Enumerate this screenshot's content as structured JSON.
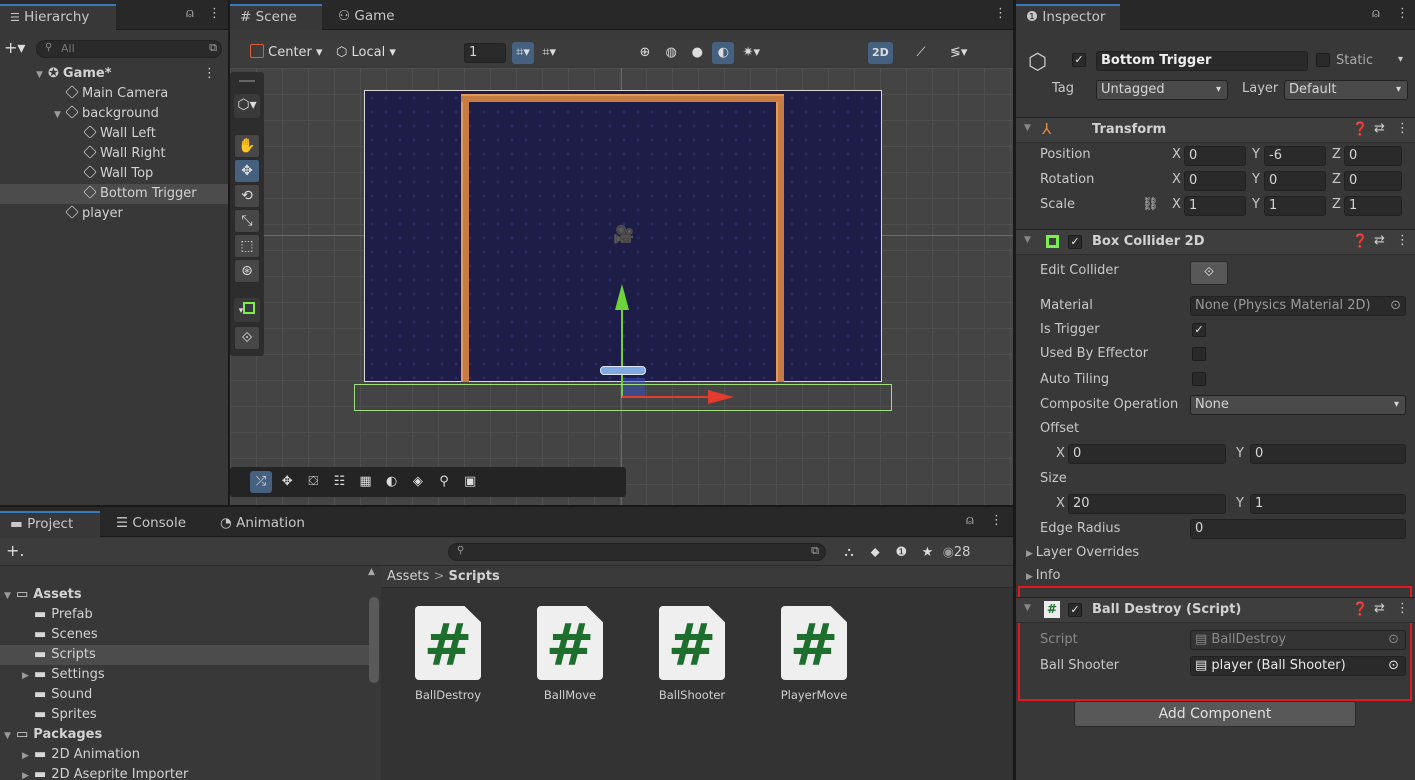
{
  "hierarchy": {
    "tab": "Hierarchy",
    "search_placeholder": "All",
    "items": [
      {
        "label": "Game*",
        "indent": 0
      },
      {
        "label": "Main Camera",
        "indent": 1
      },
      {
        "label": "background",
        "indent": 1
      },
      {
        "label": "Wall Left",
        "indent": 2
      },
      {
        "label": "Wall Right",
        "indent": 2
      },
      {
        "label": "Wall Top",
        "indent": 2
      },
      {
        "label": "Bottom Trigger",
        "indent": 2
      },
      {
        "label": "player",
        "indent": 1
      }
    ]
  },
  "scene": {
    "tab_scene": "Scene",
    "tab_game": "Game",
    "pivot_label": "Center",
    "space_label": "Local",
    "grid_value": "1",
    "mode_2d": "2D"
  },
  "inspector": {
    "tab": "Inspector",
    "object_name": "Bottom Trigger",
    "static_label": "Static",
    "tag_label": "Tag",
    "tag_value": "Untagged",
    "layer_label": "Layer",
    "layer_value": "Default",
    "transform": {
      "title": "Transform",
      "position_label": "Position",
      "rotation_label": "Rotation",
      "scale_label": "Scale",
      "position": {
        "x": "0",
        "y": "-6",
        "z": "0"
      },
      "rotation": {
        "x": "0",
        "y": "0",
        "z": "0"
      },
      "scale": {
        "x": "1",
        "y": "1",
        "z": "1"
      }
    },
    "box_collider": {
      "title": "Box Collider 2D",
      "edit_collider": "Edit Collider",
      "material_label": "Material",
      "material_value": "None (Physics Material 2D)",
      "is_trigger": "Is Trigger",
      "used_by_effector": "Used By Effector",
      "auto_tiling": "Auto Tiling",
      "composite_label": "Composite Operation",
      "composite_value": "None",
      "offset_label": "Offset",
      "offset": {
        "x": "0",
        "y": "0"
      },
      "size_label": "Size",
      "size": {
        "x": "20",
        "y": "1"
      },
      "edge_radius_label": "Edge Radius",
      "edge_radius": "0",
      "layer_overrides": "Layer Overrides",
      "info": "Info"
    },
    "ball_destroy": {
      "title": "Ball Destroy (Script)",
      "script_label": "Script",
      "script_value": "BallDestroy",
      "ball_shooter_label": "Ball Shooter",
      "ball_shooter_value": "player (Ball Shooter)"
    },
    "add_component": "Add Component"
  },
  "project": {
    "tabs": [
      "Project",
      "Console",
      "Animation"
    ],
    "breadcrumb_root": "Assets",
    "breadcrumb_sep": ">",
    "breadcrumb_current": "Scripts",
    "visible_count": "28",
    "tree": [
      {
        "label": "Assets",
        "indent": 0,
        "bold": true
      },
      {
        "label": "Prefab",
        "indent": 1
      },
      {
        "label": "Scenes",
        "indent": 1
      },
      {
        "label": "Scripts",
        "indent": 1
      },
      {
        "label": "Settings",
        "indent": 1
      },
      {
        "label": "Sound",
        "indent": 1
      },
      {
        "label": "Sprites",
        "indent": 1
      },
      {
        "label": "Packages",
        "indent": 0,
        "bold": true
      },
      {
        "label": "2D Animation",
        "indent": 1
      },
      {
        "label": "2D Aseprite Importer",
        "indent": 1
      }
    ],
    "scripts": [
      "BallDestroy",
      "BallMove",
      "BallShooter",
      "PlayerMove"
    ]
  },
  "colors": {
    "highlight": "#e0191f",
    "accent": "#3a79bb",
    "script_green": "#1e6e2e"
  }
}
